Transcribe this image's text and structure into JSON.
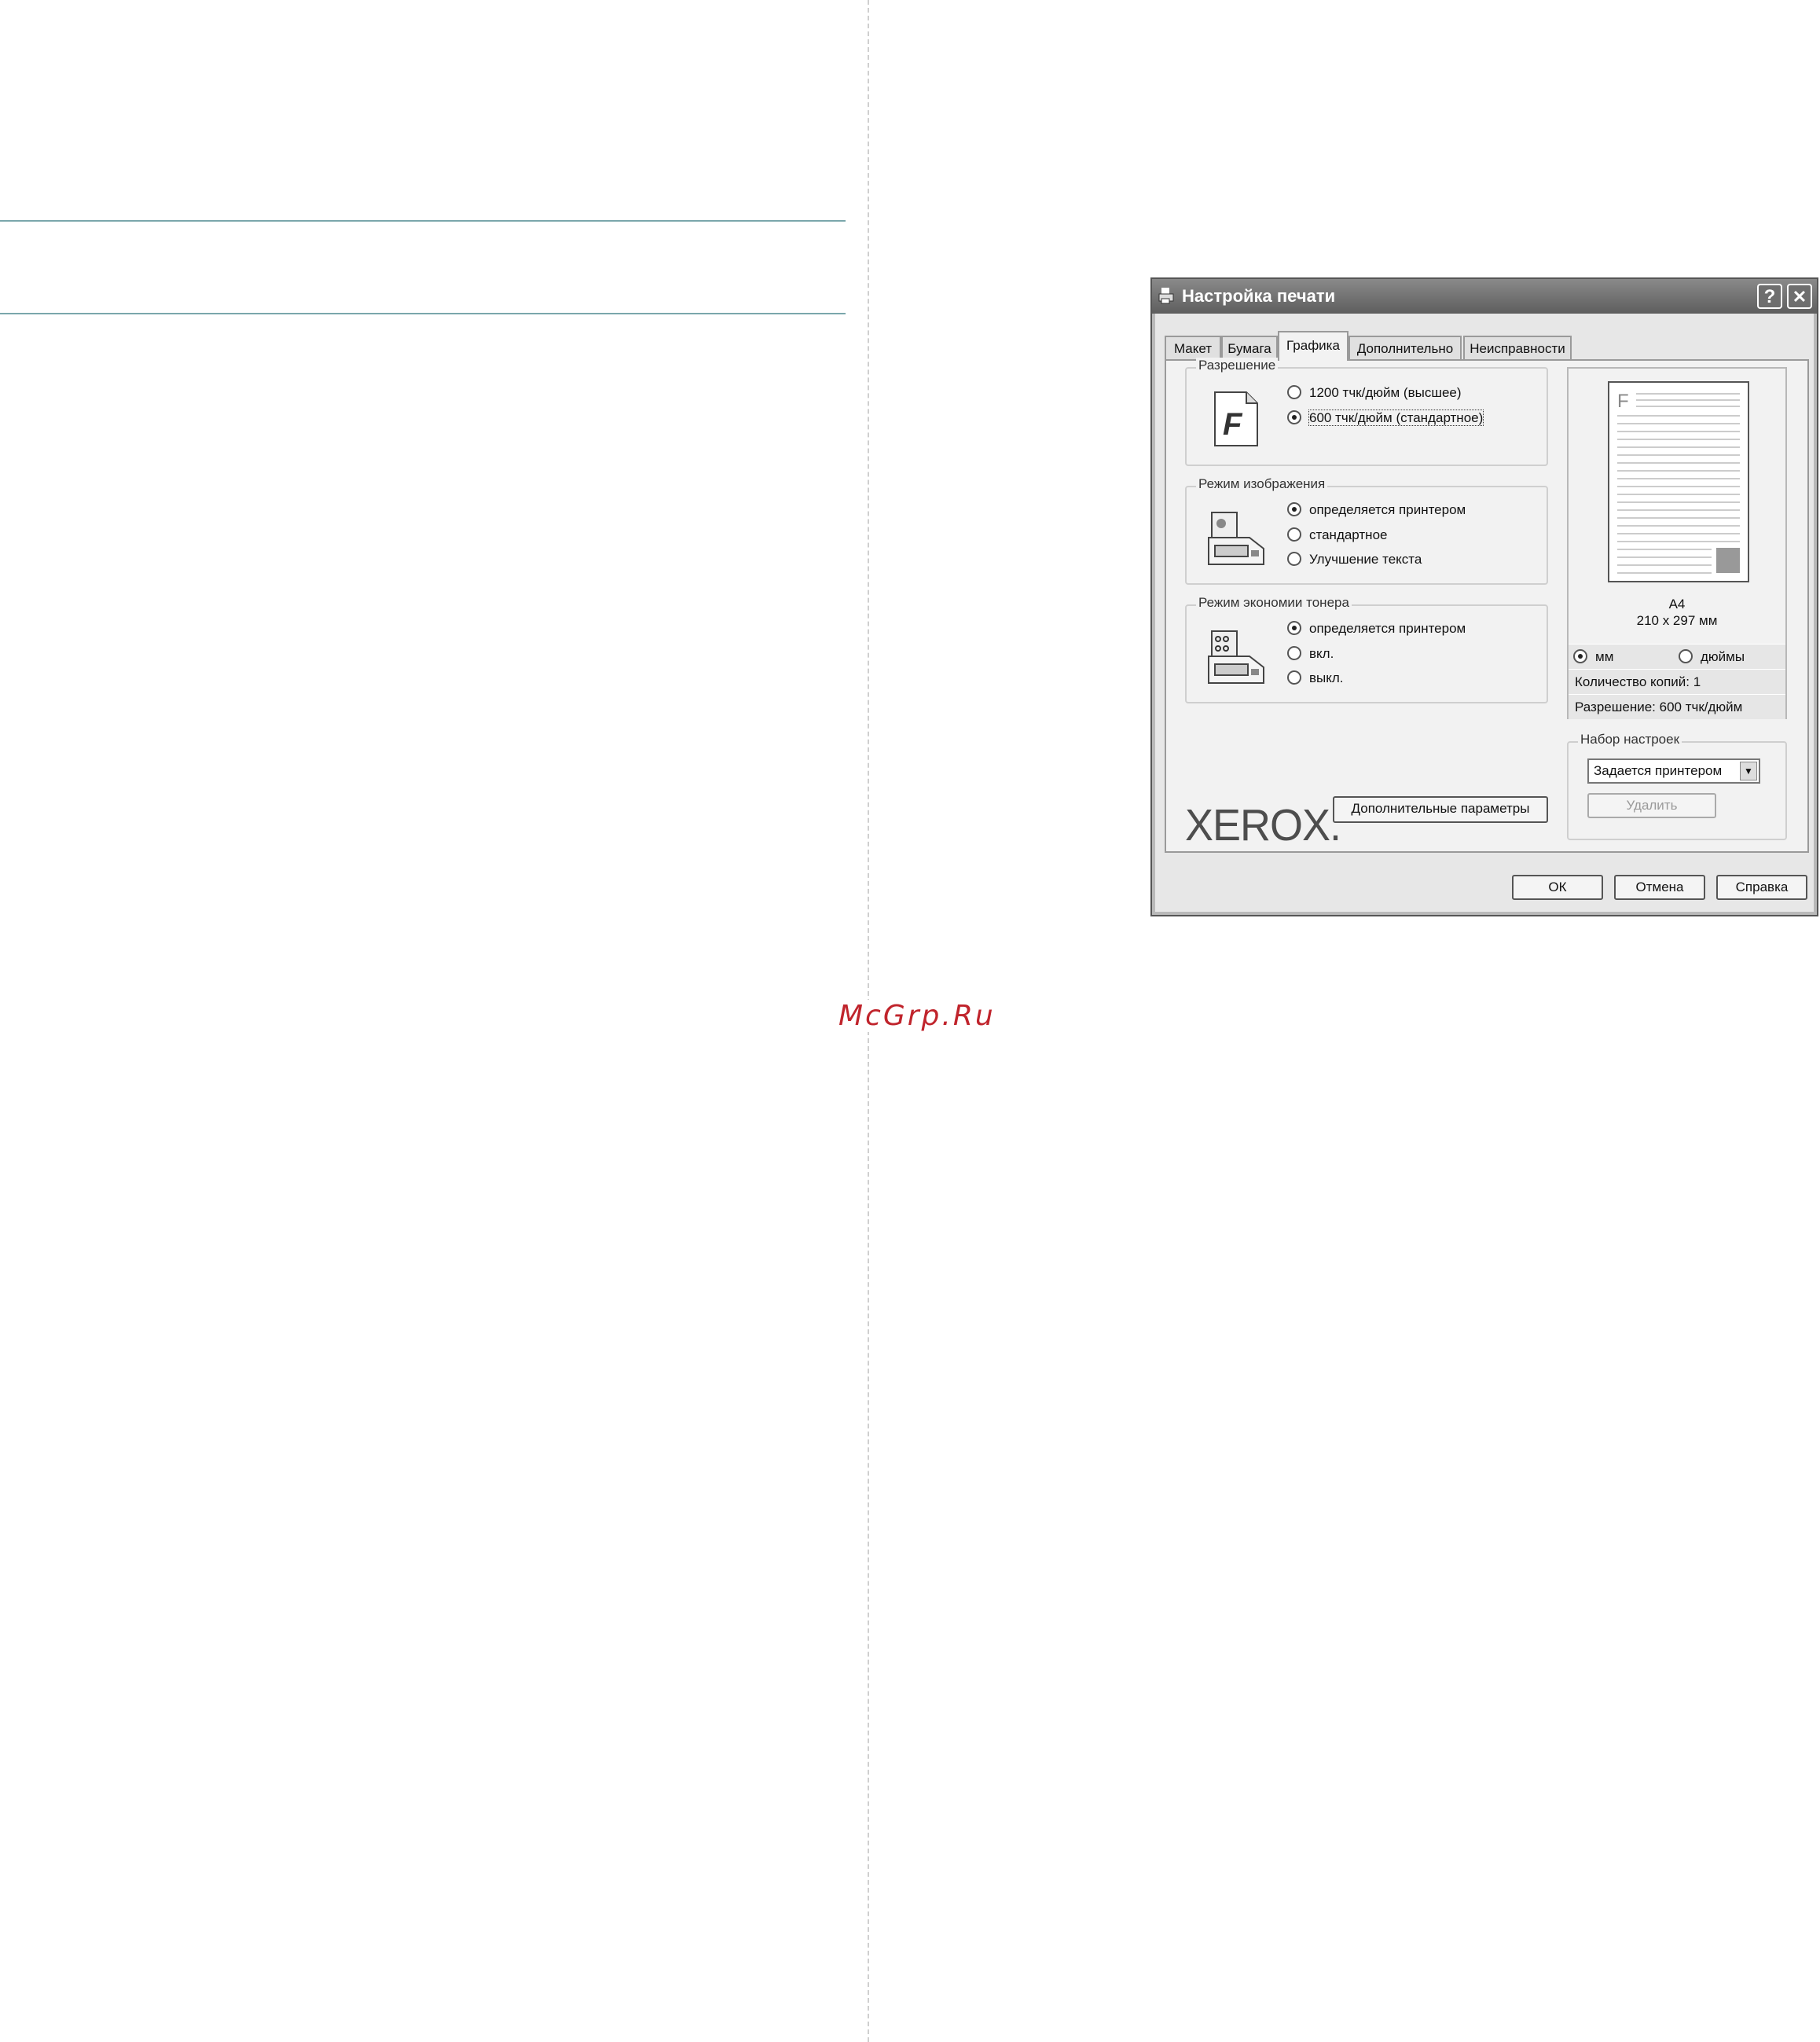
{
  "watermark": "McGrp.Ru",
  "dialog": {
    "title": "Настройка печати",
    "help_button": "?",
    "close_button": "✕",
    "tabs": [
      {
        "label": "Макет"
      },
      {
        "label": "Бумага"
      },
      {
        "label": "Графика"
      },
      {
        "label": "Дополнительно"
      },
      {
        "label": "Неисправности"
      }
    ],
    "active_tab": "Графика",
    "resolution": {
      "label": "Разрешение",
      "options": [
        "1200 тчк/дюйм (высшее)",
        "600 тчк/дюйм (стандартное)"
      ],
      "selected": "600 тчк/дюйм (стандартное)"
    },
    "image_mode": {
      "label": "Режим изображения",
      "options": [
        "определяется принтером",
        "стандартное",
        "Улучшение текста"
      ],
      "selected": "определяется принтером"
    },
    "toner_save": {
      "label": "Режим экономии тонера",
      "options": [
        "определяется принтером",
        "вкл.",
        "выкл."
      ],
      "selected": "определяется принтером"
    },
    "advanced_button": "Дополнительные параметры",
    "logo": "XEROX.",
    "preview": {
      "page_letter": "F",
      "paper_name": "A4",
      "paper_size": "210 x 297 мм",
      "units": [
        "мм",
        "дюймы"
      ],
      "units_selected": "мм",
      "copies": "Количество копий: 1",
      "resolution": "Разрешение: 600 тчк/дюйм"
    },
    "presets": {
      "label": "Набор настроек",
      "selected": "Задается принтером",
      "delete_button": "Удалить"
    },
    "ok_button": "ОК",
    "cancel_button": "Отмена",
    "help_footer_button": "Справка"
  }
}
